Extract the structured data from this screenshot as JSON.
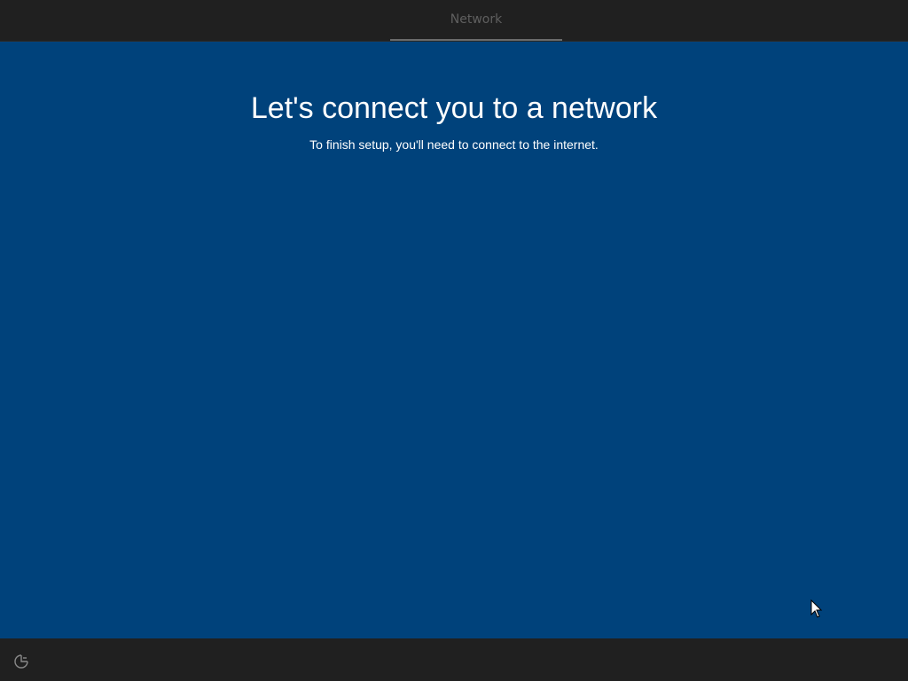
{
  "header": {
    "step_label": "Network"
  },
  "main": {
    "title": "Let's connect you to a network",
    "subtitle": "To finish setup, you'll need to connect to the internet."
  },
  "footer": {
    "icons": [
      "ease-of-access-icon"
    ]
  },
  "colors": {
    "background": "#00427b",
    "bar": "#202020",
    "text": "#ffffff",
    "tab_text": "#5f5f5f"
  }
}
